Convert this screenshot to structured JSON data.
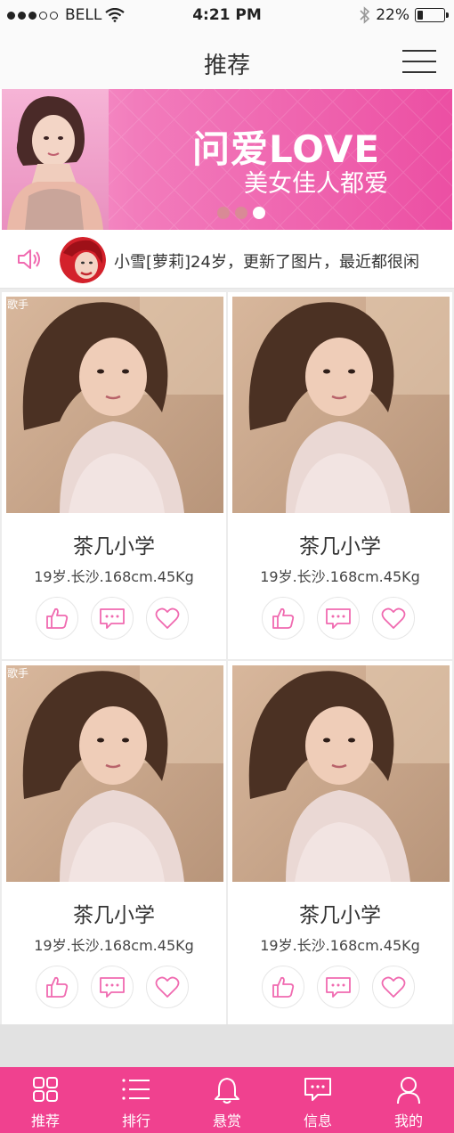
{
  "status_bar": {
    "carrier": "BELL",
    "time": "4:21 PM",
    "battery": "22%",
    "battery_level": 0.22,
    "signal_bars_filled": 3,
    "signal_bars_total": 5
  },
  "nav": {
    "title": "推荐",
    "menu_icon": "hamburger-menu-icon"
  },
  "banner": {
    "headline": "问爱LOVE",
    "tagline": "美女佳人都爱",
    "slide_count": 3,
    "active_slide": 3
  },
  "notice": {
    "icon": "speaker-icon",
    "text": "小雪[萝莉]24岁，更新了图片，最近都很闲"
  },
  "cards": [
    {
      "badge": "歌手",
      "name": "茶几小学",
      "info": "19岁.长沙.168cm.45Kg"
    },
    {
      "badge": "",
      "name": "茶几小学",
      "info": "19岁.长沙.168cm.45Kg"
    },
    {
      "badge": "歌手",
      "name": "茶几小学",
      "info": "19岁.长沙.168cm.45Kg"
    },
    {
      "badge": "",
      "name": "茶几小学",
      "info": "19岁.长沙.168cm.45Kg"
    }
  ],
  "card_actions": [
    "thumbs-up-icon",
    "comment-icon",
    "heart-icon"
  ],
  "tabs": [
    {
      "label": "推荐",
      "icon": "grid-icon"
    },
    {
      "label": "排行",
      "icon": "list-icon"
    },
    {
      "label": "悬赏",
      "icon": "bell-icon"
    },
    {
      "label": "信息",
      "icon": "message-icon"
    },
    {
      "label": "我的",
      "icon": "user-icon"
    }
  ],
  "colors": {
    "accent": "#f0418f",
    "banner_start": "#f9a6cf",
    "banner_end": "#ec4fa3",
    "icon_pink": "#f06ab0"
  }
}
